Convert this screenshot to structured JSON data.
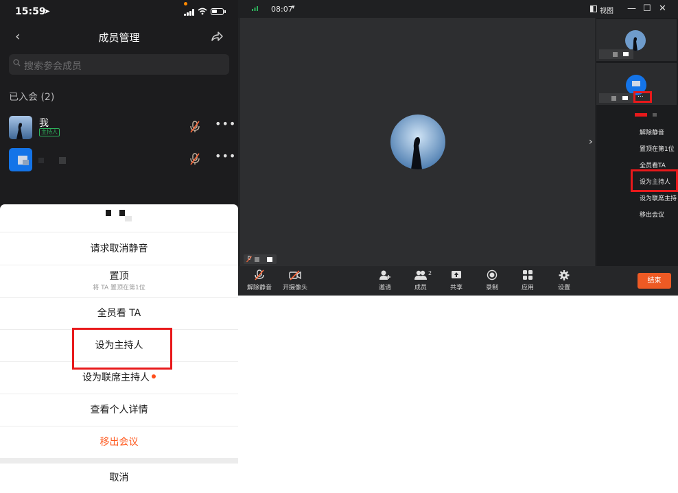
{
  "phone": {
    "status": {
      "time": "15:59",
      "location_glyph": "➤"
    },
    "nav": {
      "title": "成员管理",
      "back_glyph": "‹"
    },
    "search": {
      "placeholder": "搜索参会成员"
    },
    "section": "已入会 (2)",
    "members": [
      {
        "name": "我",
        "badge": "主持人",
        "more": "•••"
      },
      {
        "name": "",
        "badge": "",
        "more": "•••"
      }
    ],
    "sheet": {
      "rows": [
        {
          "label": "请求取消静音"
        },
        {
          "label": "置顶",
          "sub": "将 TA 置顶在第1位"
        },
        {
          "label": "全员看 TA"
        },
        {
          "label": "设为主持人"
        },
        {
          "label": "设为联席主持人"
        },
        {
          "label": "查看个人详情"
        },
        {
          "label": "移出会议"
        }
      ],
      "cancel": "取消"
    },
    "colors": {
      "accent_red": "#e8191b",
      "danger": "#ff5a1f",
      "host_badge": "#2db35c"
    }
  },
  "desktop": {
    "titlebar": {
      "time": "08:07",
      "caret": "▾",
      "view": "视图",
      "min": "—",
      "max": "☐",
      "close": "✕"
    },
    "stage": {
      "chevron": "›"
    },
    "side_menu": {
      "more": "...",
      "items": [
        "解除静音",
        "置顶在第1位",
        "全员看TA",
        "设为主持人",
        "设为联席主持",
        "移出会议"
      ]
    },
    "toolbar": {
      "items": [
        {
          "label": "解除静音",
          "icon": "mic-muted-icon"
        },
        {
          "label": "开摄像头",
          "icon": "camera-off-icon"
        },
        {
          "label": "邀请",
          "icon": "add-user-icon"
        },
        {
          "label": "成员",
          "icon": "members-icon"
        },
        {
          "label": "共享",
          "icon": "share-screen-icon"
        },
        {
          "label": "录制",
          "icon": "record-icon"
        },
        {
          "label": "应用",
          "icon": "apps-icon"
        },
        {
          "label": "设置",
          "icon": "settings-icon"
        }
      ],
      "member_count": "2",
      "end": "结束"
    },
    "colors": {
      "end_button": "#ee5a24",
      "signal": "#2db35c"
    }
  }
}
